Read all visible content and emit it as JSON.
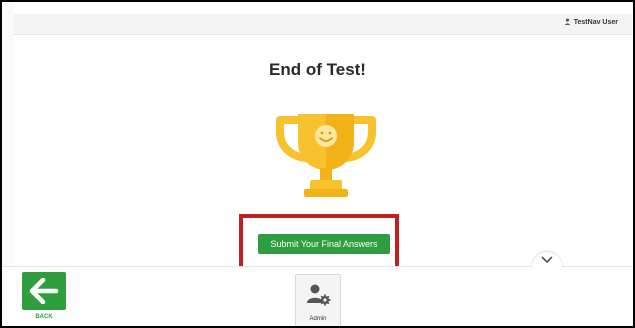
{
  "header": {
    "user_name": "TestNav User"
  },
  "main": {
    "title": "End of Test!",
    "submit_label": "Submit Your Final Answers"
  },
  "footer": {
    "back_label": "BACK",
    "admin_label": "Admin"
  },
  "icons": {
    "user": "user-icon",
    "trophy": "trophy-icon",
    "back": "back-arrow-icon",
    "admin": "admin-gear-icon",
    "chevron": "chevron-down-icon"
  },
  "colors": {
    "accent_green": "#2e9e3f",
    "trophy_gold": "#f8c12e",
    "highlight_red": "#c0201e"
  }
}
